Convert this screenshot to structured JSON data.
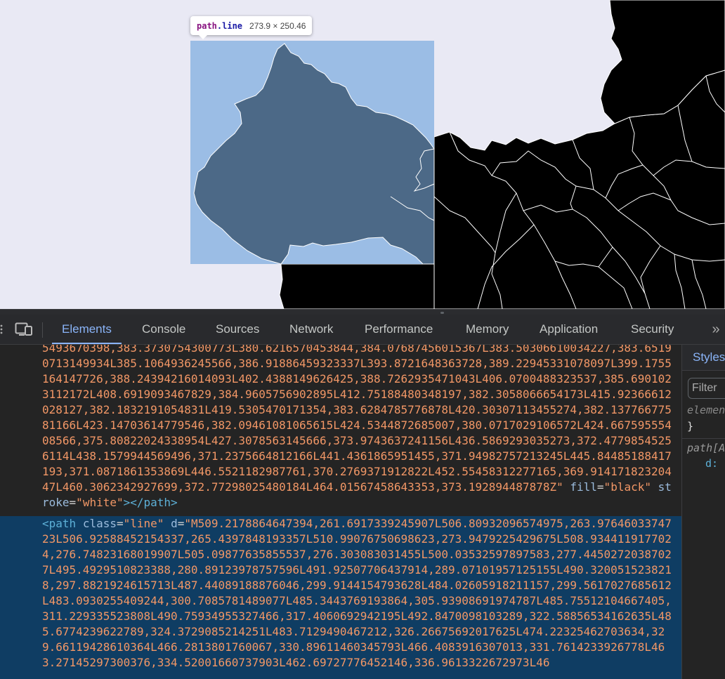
{
  "tooltip": {
    "element": "path",
    "class": ".line",
    "size": "273.9 × 250.46"
  },
  "devtools": {
    "tabs": [
      "Elements",
      "Console",
      "Sources",
      "Network",
      "Performance",
      "Memory",
      "Application",
      "Security"
    ],
    "active_tab": "Elements",
    "more_icon": "chevron-double-right-icon",
    "inspect_icon": "inspect-element-icon",
    "device_icon": "device-toolbar-icon"
  },
  "code_prev": {
    "d_fragment": "5493670398,383.3730754300773L380.6216570453844,384.07687456015367L383.50306610034227,383.65190713149934L385.1064936245566,386.91886459323337L393.8721648363728,389.22945331078097L399.1755164147726,388.24394216014093L402.4388149626425,388.7262935471043L406.0700488323537,385.6901023112172L408.6919093467829,384.9605756902895L412.75188480348197,382.3058066654173L415.92366612028127,382.1832191054831L419.5305470171354,383.6284785776878L420.30307113455274,382.13776677581166L423.14703614779546,382.09461081065615L424.5344872685007,380.0717029106572L424.66759555408566,375.80822024338954L427.3078563145666,373.9743637241156L436.5869293035273,372.47798545256114L438.1579944569496,371.2375664812166L441.4361865951455,371.94982757213245L445.84485188417193,371.0871861353869L446.5521182987761,370.2769371912822L452.55458312277165,369.91417182320447L460.3062342927699,372.77298025480184L464.01567458643353,373.192894487878Z",
    "fill_attr": "fill",
    "fill": "black",
    "stroke_attr": "stroke",
    "stroke": "white",
    "close_tag": "></path>"
  },
  "code_selected": {
    "open_tag": "<path",
    "class_attr": "class",
    "class_value": "line",
    "d_attr": "d",
    "d_value": "M509.2178864647394,261.6917339245907L506.80932096574975,263.9764603374723L506.92588452154337,265.4397848193357L510.99076750698623,273.9479225429675L508.9344119177024,276.74823168019907L505.09877635855537,276.303083031455L500.03532597897583,277.44502720387027L495.4929510823388,280.89123978757596L491.92507706437914,289.07101957125155L490.3200515238218,297.8821924615713L487.44089188876046,299.9144154793628L484.02605918211157,299.5617027685612L483.0930255409244,300.7085781489077L485.3443769193864,305.93908691974787L485.75512104667405,311.229335523808L490.75934955327466,317.4060692942195L492.8470098103289,322.58856534162635L485.6774239622789,324.3729085214251L483.7129490467212,326.26675692017625L474.22325462703634,329.66119428610364L466.2813801760067,330.89611460345793L466.4083916307013,331.7614233926778L463.27145297300376,334.52001660737903L462.69727776452146,336.9613322672973L46"
  },
  "styles": {
    "tab": "Styles",
    "filter_placeholder": "Filter",
    "element_style": "elemen",
    "close_brace": "}",
    "rule_selector": "path[A",
    "rule_prop": "d:"
  }
}
